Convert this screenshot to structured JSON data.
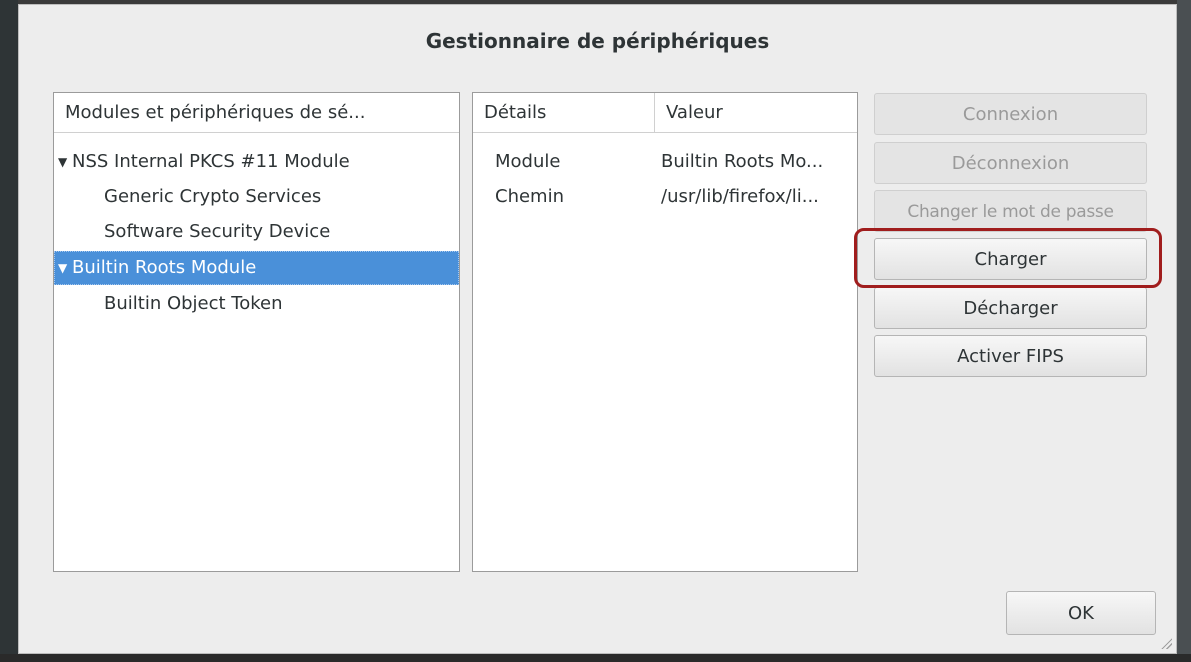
{
  "window": {
    "title": "Gestionnaire de périphériques"
  },
  "tree": {
    "header": "Modules et périphériques de sé...",
    "expander_glyph": "▼",
    "items": [
      {
        "label": "NSS Internal PKCS #11 Module",
        "level": 0,
        "expanded": true,
        "selected": false
      },
      {
        "label": "Generic Crypto Services",
        "level": 1,
        "selected": false
      },
      {
        "label": "Software Security Device",
        "level": 1,
        "selected": false
      },
      {
        "label": "Builtin Roots Module",
        "level": 0,
        "expanded": true,
        "selected": true
      },
      {
        "label": "Builtin Object Token",
        "level": 1,
        "selected": false
      }
    ]
  },
  "details": {
    "headers": {
      "name": "Détails",
      "value": "Valeur"
    },
    "rows": [
      {
        "name": "Module",
        "value": "Builtin Roots Mo..."
      },
      {
        "name": "Chemin",
        "value": "/usr/lib/firefox/li..."
      }
    ]
  },
  "buttons": {
    "login": {
      "label": "Connexion",
      "enabled": false
    },
    "logout": {
      "label": "Déconnexion",
      "enabled": false
    },
    "change_password": {
      "label": "Changer le mot de passe",
      "enabled": false
    },
    "load": {
      "label": "Charger",
      "enabled": true,
      "highlighted": true
    },
    "unload": {
      "label": "Décharger",
      "enabled": true
    },
    "enable_fips": {
      "label": "Activer FIPS",
      "enabled": true
    },
    "ok": {
      "label": "OK",
      "enabled": true
    }
  },
  "colors": {
    "selection": "#4a90d9",
    "highlight_ring": "#a01d1d"
  }
}
